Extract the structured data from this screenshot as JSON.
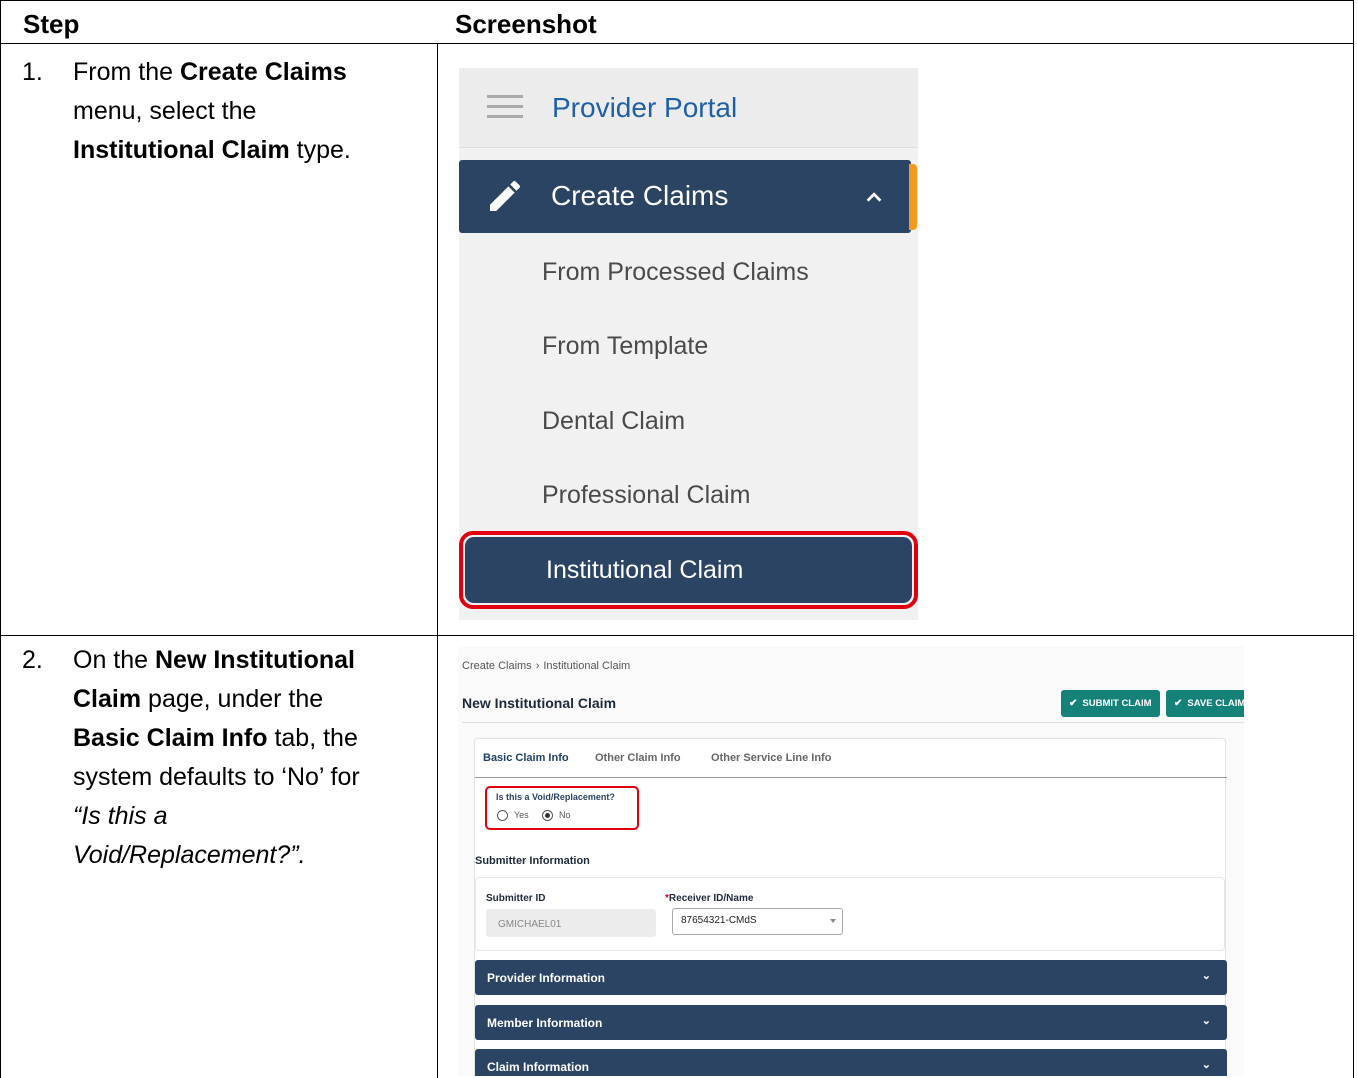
{
  "table": {
    "headers": [
      "Step",
      "Screenshot"
    ]
  },
  "step1": {
    "number": "1.",
    "lines": [
      [
        "From the ",
        "Create Claims"
      ],
      [
        "menu, select the"
      ],
      [
        "Institutional Claim",
        " type."
      ]
    ],
    "menu": {
      "portal_title": "Provider Portal",
      "section_label": "Create Claims",
      "items": [
        "From Processed Claims",
        "From Template",
        "Dental Claim",
        "Professional Claim"
      ],
      "selected_item": "Institutional Claim",
      "colors": {
        "nav": "#2b4464",
        "accent": "#f39a1d",
        "highlight": "#e0000f",
        "title": "#1f5fa6"
      }
    }
  },
  "step2": {
    "number": "2.",
    "text": {
      "l1a": "On the ",
      "l1b": "New Institutional",
      "l2a": "Claim",
      "l2b": " page, under the",
      "l3a": "Basic Claim Info",
      "l3b": " tab, the",
      "l4": "system defaults to ‘No’ for",
      "l5": "“Is this a",
      "l6": "Void/Replacement?”."
    },
    "form": {
      "breadcrumb": [
        "Create Claims",
        "Institutional Claim"
      ],
      "breadcrumb_sep": "›",
      "page_title": "New Institutional Claim",
      "buttons": {
        "submit": "SUBMIT CLAIM",
        "save": "SAVE CLAIM"
      },
      "tabs": [
        "Basic Claim Info",
        "Other Claim Info",
        "Other Service Line Info"
      ],
      "void_question": "Is this a Void/Replacement?",
      "radio_yes": "Yes",
      "radio_no": "No",
      "selected_radio": "No",
      "submitter_section": "Submitter Information",
      "submitter_id_label": "Submitter ID",
      "submitter_id_value": "GMICHAEL01",
      "receiver_required_mark": "*",
      "receiver_label": "Receiver ID/Name",
      "receiver_value": "87654321-CMdS",
      "accordions": [
        "Provider Information",
        "Member Information",
        "Claim Information"
      ],
      "chevron_glyph": "⌄",
      "check_glyph": "✔",
      "colors": {
        "button": "#15827a",
        "nav": "#2b4464"
      }
    }
  }
}
